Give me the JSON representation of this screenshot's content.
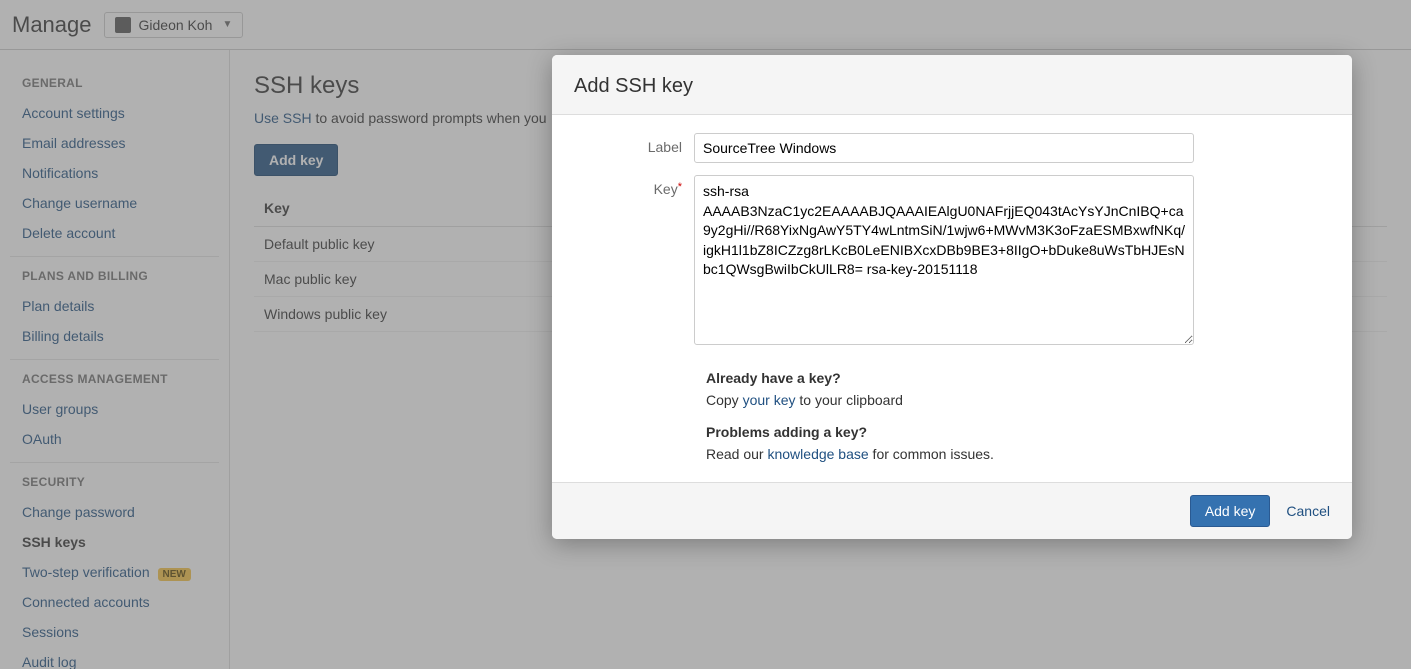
{
  "topbar": {
    "title": "Manage",
    "user_name": "Gideon Koh"
  },
  "sidebar": {
    "general": {
      "heading": "GENERAL",
      "items": [
        {
          "label": "Account settings"
        },
        {
          "label": "Email addresses"
        },
        {
          "label": "Notifications"
        },
        {
          "label": "Change username"
        },
        {
          "label": "Delete account"
        }
      ]
    },
    "plans": {
      "heading": "PLANS AND BILLING",
      "items": [
        {
          "label": "Plan details"
        },
        {
          "label": "Billing details"
        }
      ]
    },
    "access": {
      "heading": "ACCESS MANAGEMENT",
      "items": [
        {
          "label": "User groups"
        },
        {
          "label": "OAuth"
        }
      ]
    },
    "security": {
      "heading": "SECURITY",
      "items": [
        {
          "label": "Change password"
        },
        {
          "label": "SSH keys"
        },
        {
          "label": "Two-step verification"
        },
        {
          "label": "Connected accounts"
        },
        {
          "label": "Sessions"
        },
        {
          "label": "Audit log"
        }
      ],
      "new_badge": "NEW"
    }
  },
  "page": {
    "title": "SSH keys",
    "desc_link": "Use SSH",
    "desc_rest": " to avoid password prompts when you",
    "add_btn": "Add key",
    "table_header": "Key",
    "rows": [
      {
        "label": "Default public key"
      },
      {
        "label": "Mac public key"
      },
      {
        "label": "Windows public key"
      }
    ]
  },
  "modal": {
    "title": "Add SSH key",
    "label_label": "Label",
    "label_value": "SourceTree Windows",
    "key_label": "Key",
    "key_value": "ssh-rsa AAAAB3NzaC1yc2EAAAABJQAAAIEAlgU0NAFrjjEQ043tAcYsYJnCnIBQ+ca9y2gHi//R68YixNgAwY5TY4wLntmSiN/1wjw6+MWvM3K3oFzaESMBxwfNKq/igkH1l1bZ8ICZzg8rLKcB0LeENIBXcxDBb9BE3+8IIgO+bDuke8uWsTbHJEsNbc1QWsgBwiIbCkUlLR8= rsa-key-20151118",
    "help": {
      "have_key_h": "Already have a key?",
      "have_key_pre": "Copy ",
      "have_key_link": "your key",
      "have_key_post": " to your clipboard",
      "problems_h": "Problems adding a key?",
      "problems_pre": "Read our ",
      "problems_link": "knowledge base",
      "problems_post": " for common issues."
    },
    "submit": "Add key",
    "cancel": "Cancel"
  }
}
